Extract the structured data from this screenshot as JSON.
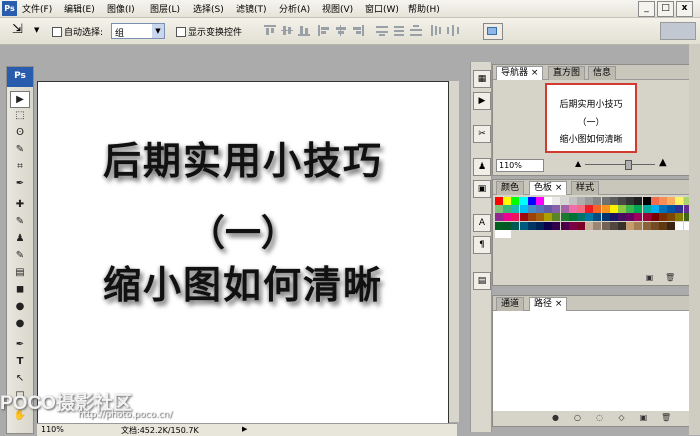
{
  "app": {
    "logo": "Ps"
  },
  "menu": {
    "items": [
      "文件(F)",
      "编辑(E)",
      "图像(I)",
      "图层(L)",
      "选择(S)",
      "滤镜(T)",
      "分析(A)",
      "视图(V)",
      "窗口(W)",
      "帮助(H)"
    ],
    "window_buttons": [
      "_",
      "□",
      "x"
    ]
  },
  "options": {
    "auto_select_label": "自动选择:",
    "auto_select_value": "组",
    "show_transform_label": "显示变换控件"
  },
  "toolbox": {
    "header": "Ps",
    "tools": [
      "▶",
      "⬚",
      "ʘ",
      "✎",
      "⌗",
      "✒",
      "✚",
      "✎",
      "♟",
      "✎",
      "▤",
      "◼",
      "●",
      "●",
      "✒",
      "T",
      "↖",
      "□",
      "✋"
    ]
  },
  "document": {
    "line1": "后期实用小技巧",
    "line2": "（一）",
    "line3": "缩小图如何清晰"
  },
  "status": {
    "zoom": "110%",
    "doc_info": "文档:452.2K/150.7K"
  },
  "navigator": {
    "tabs": [
      "导航器",
      "直方图",
      "信息"
    ],
    "thumb_lines": [
      "后期实用小技巧",
      "（一）",
      "缩小图如何清晰"
    ],
    "zoom": "110%"
  },
  "swatches_panel": {
    "tabs": [
      "颜色",
      "色板",
      "样式"
    ],
    "colors": [
      "#ff0000",
      "#ffff00",
      "#00ff00",
      "#00ffff",
      "#0000ff",
      "#ff00ff",
      "#ffffff",
      "#ebebeb",
      "#d6d6d6",
      "#c2c2c2",
      "#adadad",
      "#999999",
      "#858585",
      "#707070",
      "#5c5c5c",
      "#474747",
      "#333333",
      "#1f1f1f",
      "#000000",
      "#f26c4f",
      "#f68e55",
      "#fbaf5c",
      "#fff467",
      "#acd372",
      "#7cc576",
      "#3bb878",
      "#1abbb4",
      "#00bff3",
      "#438ccb",
      "#5574b9",
      "#605ca8",
      "#855fa8",
      "#a763a8",
      "#f06ea9",
      "#f26d7d",
      "#ed1c24",
      "#f26522",
      "#f7941d",
      "#fff200",
      "#8dc63f",
      "#39b54a",
      "#00a651",
      "#00a99d",
      "#00aeef",
      "#0072bc",
      "#0054a6",
      "#2e3192",
      "#662d91",
      "#92278f",
      "#ec008c",
      "#ed145b",
      "#9e0b0f",
      "#a0410d",
      "#a36209",
      "#aba000",
      "#598527",
      "#1a7b30",
      "#007236",
      "#00746b",
      "#0076a3",
      "#004b80",
      "#003471",
      "#1b1464",
      "#440e62",
      "#630460",
      "#9e005d",
      "#9e0039",
      "#790000",
      "#7b2e00",
      "#7d4900",
      "#827b00",
      "#406618",
      "#005e20",
      "#005826",
      "#005952",
      "#005b7f",
      "#003663",
      "#002157",
      "#0d004c",
      "#32004b",
      "#4b0049",
      "#7b0046",
      "#7a0026",
      "#c7b299",
      "#998675",
      "#736357",
      "#534741",
      "#37302d",
      "#c69c6d",
      "#a67c52",
      "#8c6239",
      "#754c24",
      "#603913",
      "#3c2415",
      "#ffffff",
      "#ffffff",
      "#ffffff",
      "#ffffff"
    ]
  },
  "paths_panel": {
    "tabs": [
      "通道",
      "路径"
    ]
  },
  "watermark": {
    "main": "POCO摄影社区",
    "url": "http://photo.poco.cn/"
  },
  "icons": [
    "move-icon",
    "marquee-icon",
    "lasso-icon",
    "magic-wand-icon",
    "crop-icon",
    "eyedropper-icon",
    "healing-icon",
    "brush-icon",
    "stamp-icon",
    "history-brush-icon",
    "eraser-icon",
    "gradient-icon",
    "blur-icon",
    "dodge-icon",
    "pen-icon",
    "type-icon",
    "path-select-icon",
    "shape-icon",
    "hand-icon"
  ]
}
